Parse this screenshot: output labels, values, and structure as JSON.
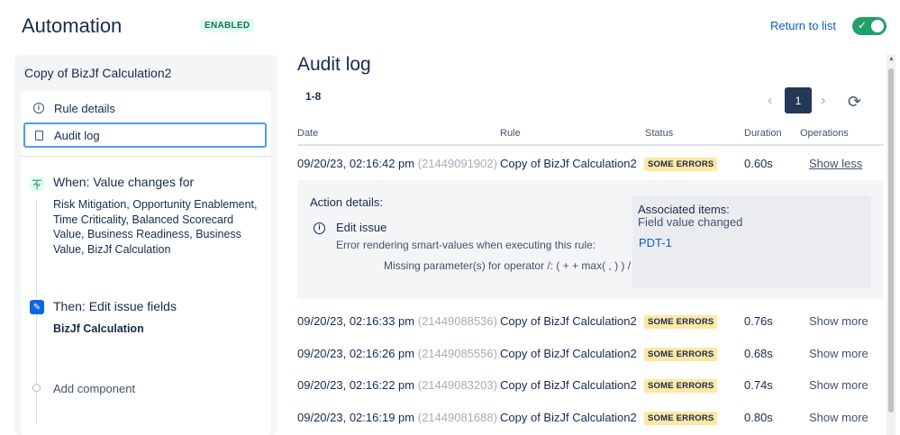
{
  "header": {
    "title": "Automation",
    "status_badge": "ENABLED",
    "return_link": "Return to list",
    "toggle_check": "✓"
  },
  "sidebar": {
    "rule_name": "Copy of BizJf Calculation2",
    "nav": [
      {
        "label": "Rule details"
      },
      {
        "label": "Audit log"
      }
    ],
    "trigger": {
      "icon": "⏇",
      "title": "When: Value changes for",
      "description": "Risk Mitigation, Opportunity Enablement, Time Criticality, Balanced Scorecard Value, Business Readiness, Business Value, BizJf Calculation"
    },
    "action": {
      "icon": "✎",
      "title": "Then: Edit issue fields",
      "description": "BizJf Calculation"
    },
    "add_component": "Add component"
  },
  "main": {
    "title": "Audit log",
    "range": "1-8",
    "pagination": {
      "prev": "‹",
      "page": "1",
      "next": "›",
      "refresh": "⟳"
    },
    "columns": [
      "Date",
      "Rule",
      "Status",
      "Duration",
      "Operations"
    ],
    "rows": [
      {
        "date": "09/20/23, 02:16:42 pm",
        "id": "(21449091902)",
        "rule": "Copy of BizJf Calculation2",
        "status": "SOME ERRORS",
        "duration": "0.60s",
        "op": "Show less"
      },
      {
        "date": "09/20/23, 02:16:33 pm",
        "id": "(21449088536)",
        "rule": "Copy of BizJf Calculation2",
        "status": "SOME ERRORS",
        "duration": "0.76s",
        "op": "Show more"
      },
      {
        "date": "09/20/23, 02:16:26 pm",
        "id": "(21449085556)",
        "rule": "Copy of BizJf Calculation2",
        "status": "SOME ERRORS",
        "duration": "0.68s",
        "op": "Show more"
      },
      {
        "date": "09/20/23, 02:16:22 pm",
        "id": "(21449083203)",
        "rule": "Copy of BizJf Calculation2",
        "status": "SOME ERRORS",
        "duration": "0.74s",
        "op": "Show more"
      },
      {
        "date": "09/20/23, 02:16:19 pm",
        "id": "(21449081688)",
        "rule": "Copy of BizJf Calculation2",
        "status": "SOME ERRORS",
        "duration": "0.80s",
        "op": "Show more"
      }
    ],
    "details": {
      "title": "Action details:",
      "action_name": "Edit issue",
      "error": "Error rendering smart-values when executing this rule:",
      "message": "Missing parameter(s) for operator /: ( + + max( , ) ) /",
      "associated_title": "Associated items:",
      "associated_sub": "Field value changed",
      "associated_link": "PDT-1"
    }
  }
}
